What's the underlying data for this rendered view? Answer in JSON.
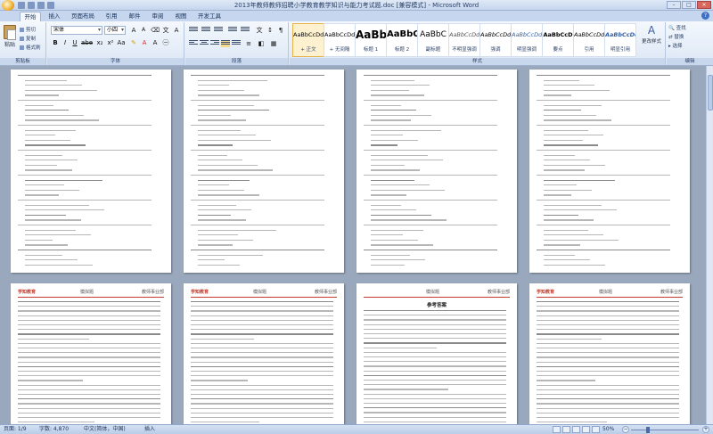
{
  "window": {
    "title": "2013年教师教师招聘小学教育教学知识与能力考试题.doc [兼容模式] - Microsoft Word"
  },
  "tabs": [
    {
      "label": "开始",
      "active": true
    },
    {
      "label": "插入"
    },
    {
      "label": "页面布局"
    },
    {
      "label": "引用"
    },
    {
      "label": "邮件"
    },
    {
      "label": "审阅"
    },
    {
      "label": "视图"
    },
    {
      "label": "开发工具"
    }
  ],
  "ribbon": {
    "clipboard": {
      "paste_label": "粘贴",
      "cut_label": "剪切",
      "copy_label": "复制",
      "format_painter_label": "格式刷",
      "group_label": "剪贴板"
    },
    "font": {
      "font_name": "宋体",
      "font_size": "小四",
      "group_label": "字体"
    },
    "paragraph": {
      "group_label": "段落"
    },
    "styles": {
      "group_label": "样式",
      "items": [
        {
          "sample": "AaBbCcDd",
          "name": "+ 正文",
          "selected": true
        },
        {
          "sample": "AaBbCcDd",
          "name": "+ 无间隔"
        },
        {
          "sample": "AaBb",
          "name": "标题 1"
        },
        {
          "sample": "AaBbC",
          "name": "标题 2"
        },
        {
          "sample": "AaBbC",
          "name": "副标题"
        },
        {
          "sample": "AaBbCcDd",
          "name": "不明显强调"
        },
        {
          "sample": "AaBbCcDd",
          "name": "强调"
        },
        {
          "sample": "AaBbCcDd",
          "name": "明显强调"
        },
        {
          "sample": "AaBbCcD",
          "name": "要点"
        },
        {
          "sample": "AaBbCcDd",
          "name": "引用"
        },
        {
          "sample": "AaBbCcDd",
          "name": "明显引用"
        }
      ],
      "change_styles_label": "更改样式"
    },
    "editing": {
      "group_label": "编辑",
      "find_label": "查找",
      "replace_label": "替换",
      "select_label": "选择"
    }
  },
  "pages": [
    {
      "header": null,
      "title": ""
    },
    {
      "header": null,
      "title": ""
    },
    {
      "header": null,
      "title": ""
    },
    {
      "header": null,
      "title": ""
    },
    {
      "header": {
        "logo": "学知教育",
        "mid": "模拟题",
        "right": "教师事业部"
      },
      "title": ""
    },
    {
      "header": {
        "logo": "学知教育",
        "mid": "模拟题",
        "right": "教师事业部"
      },
      "title": ""
    },
    {
      "header": {
        "logo": "",
        "mid": "模拟题",
        "right": "教师事业部"
      },
      "title": "参考答案"
    },
    {
      "header": {
        "logo": "学知教育",
        "mid": "模拟题",
        "right": "教师事业部"
      },
      "title": ""
    }
  ],
  "statusbar": {
    "page": "页面: 1/9",
    "words": "字数: 4,870",
    "language": "中文(简体，中国)",
    "mode": "插入",
    "zoom": "50%",
    "zoom_level": 50
  }
}
